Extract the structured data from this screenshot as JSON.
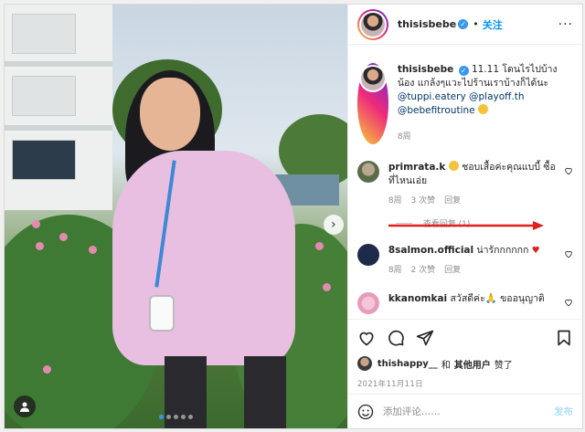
{
  "colors": {
    "accent": "#0095f6",
    "verified": "#3897f0",
    "heart_red": "#ed4956",
    "annotation_arrow": "#e0201b"
  },
  "photo": {
    "alt_icons": [
      "chevron-right-icon",
      "person-tag-icon"
    ],
    "carousel_dots": 5,
    "carousel_active": 1
  },
  "header": {
    "username": "thisisbebe",
    "separator": "•",
    "follow_label": "关注",
    "more_label": "···"
  },
  "caption": {
    "username": "thisisbebe",
    "text": "11.11 โดนไรไปบ้างน้อง แกล้งๆแวะไปร้านเราบ้างก็ได้นะ",
    "mention1": "@tuppi.eatery",
    "mention2": "@playoff.th",
    "mention3": "@bebefitroutine",
    "time": "8周"
  },
  "comments": [
    {
      "username": "primrata.k",
      "text": "ชอบเสื้อค่ะคุณแบบี้ ซื้อที่ไหนเอ่ย",
      "time": "8周",
      "likes": "3 次赞",
      "reply": "回复",
      "view_replies": "查看回复 (1)"
    },
    {
      "username": "8salmon.official",
      "text": "น่ารักกกกกก",
      "time": "8周",
      "likes": "2 次赞",
      "reply": "回复"
    },
    {
      "username": "kkanomkai",
      "text": "สวัสดีค่ะ🙏 ขออนุญาติ"
    }
  ],
  "liked_by": {
    "username": "thishappy__",
    "connector": "和",
    "others": "其他用户",
    "suffix": "赞了"
  },
  "date": "2021年11月11日",
  "comment_box": {
    "placeholder": "添加评论……",
    "post_label": "发布"
  }
}
